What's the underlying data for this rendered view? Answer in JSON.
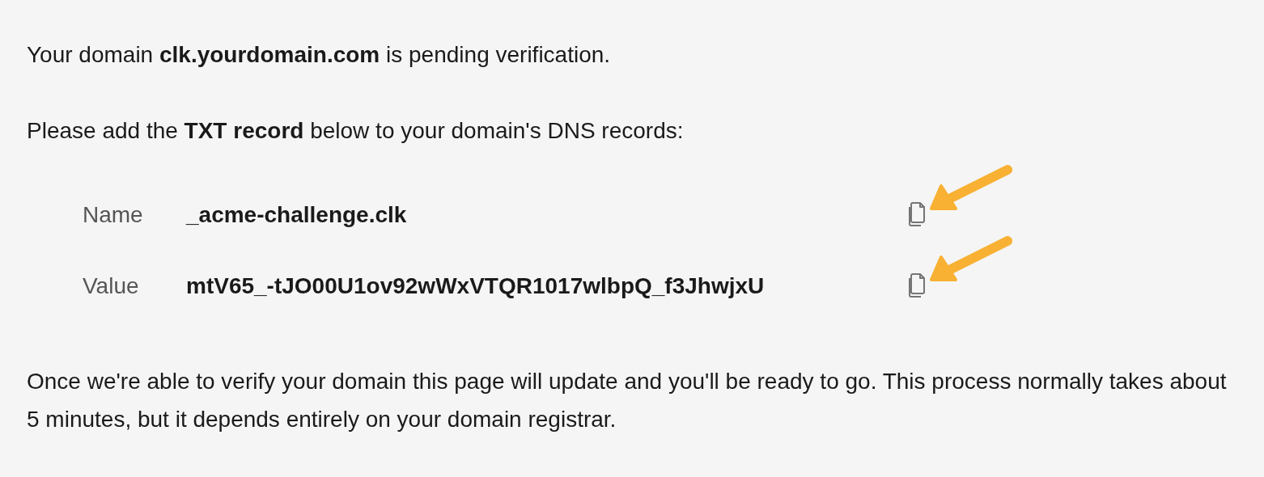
{
  "intro": "Your domain **clk.yourdomain.com** is pending verification.",
  "instruction": "Please add the **TXT record** below to your domain's DNS records:",
  "records": [
    {
      "label": "Name",
      "value": "_acme-challenge.clk",
      "annotated": true
    },
    {
      "label": "Value",
      "value": "mtV65_-tJO00U1ov92wWxVTQR1017wlbpQ_f3JhwjxU",
      "annotated": true
    }
  ],
  "footer": "Once we're able to verify your domain this page will update and you'll be ready to go. This process normally takes about 5 minutes, but it depends entirely on your domain registrar."
}
